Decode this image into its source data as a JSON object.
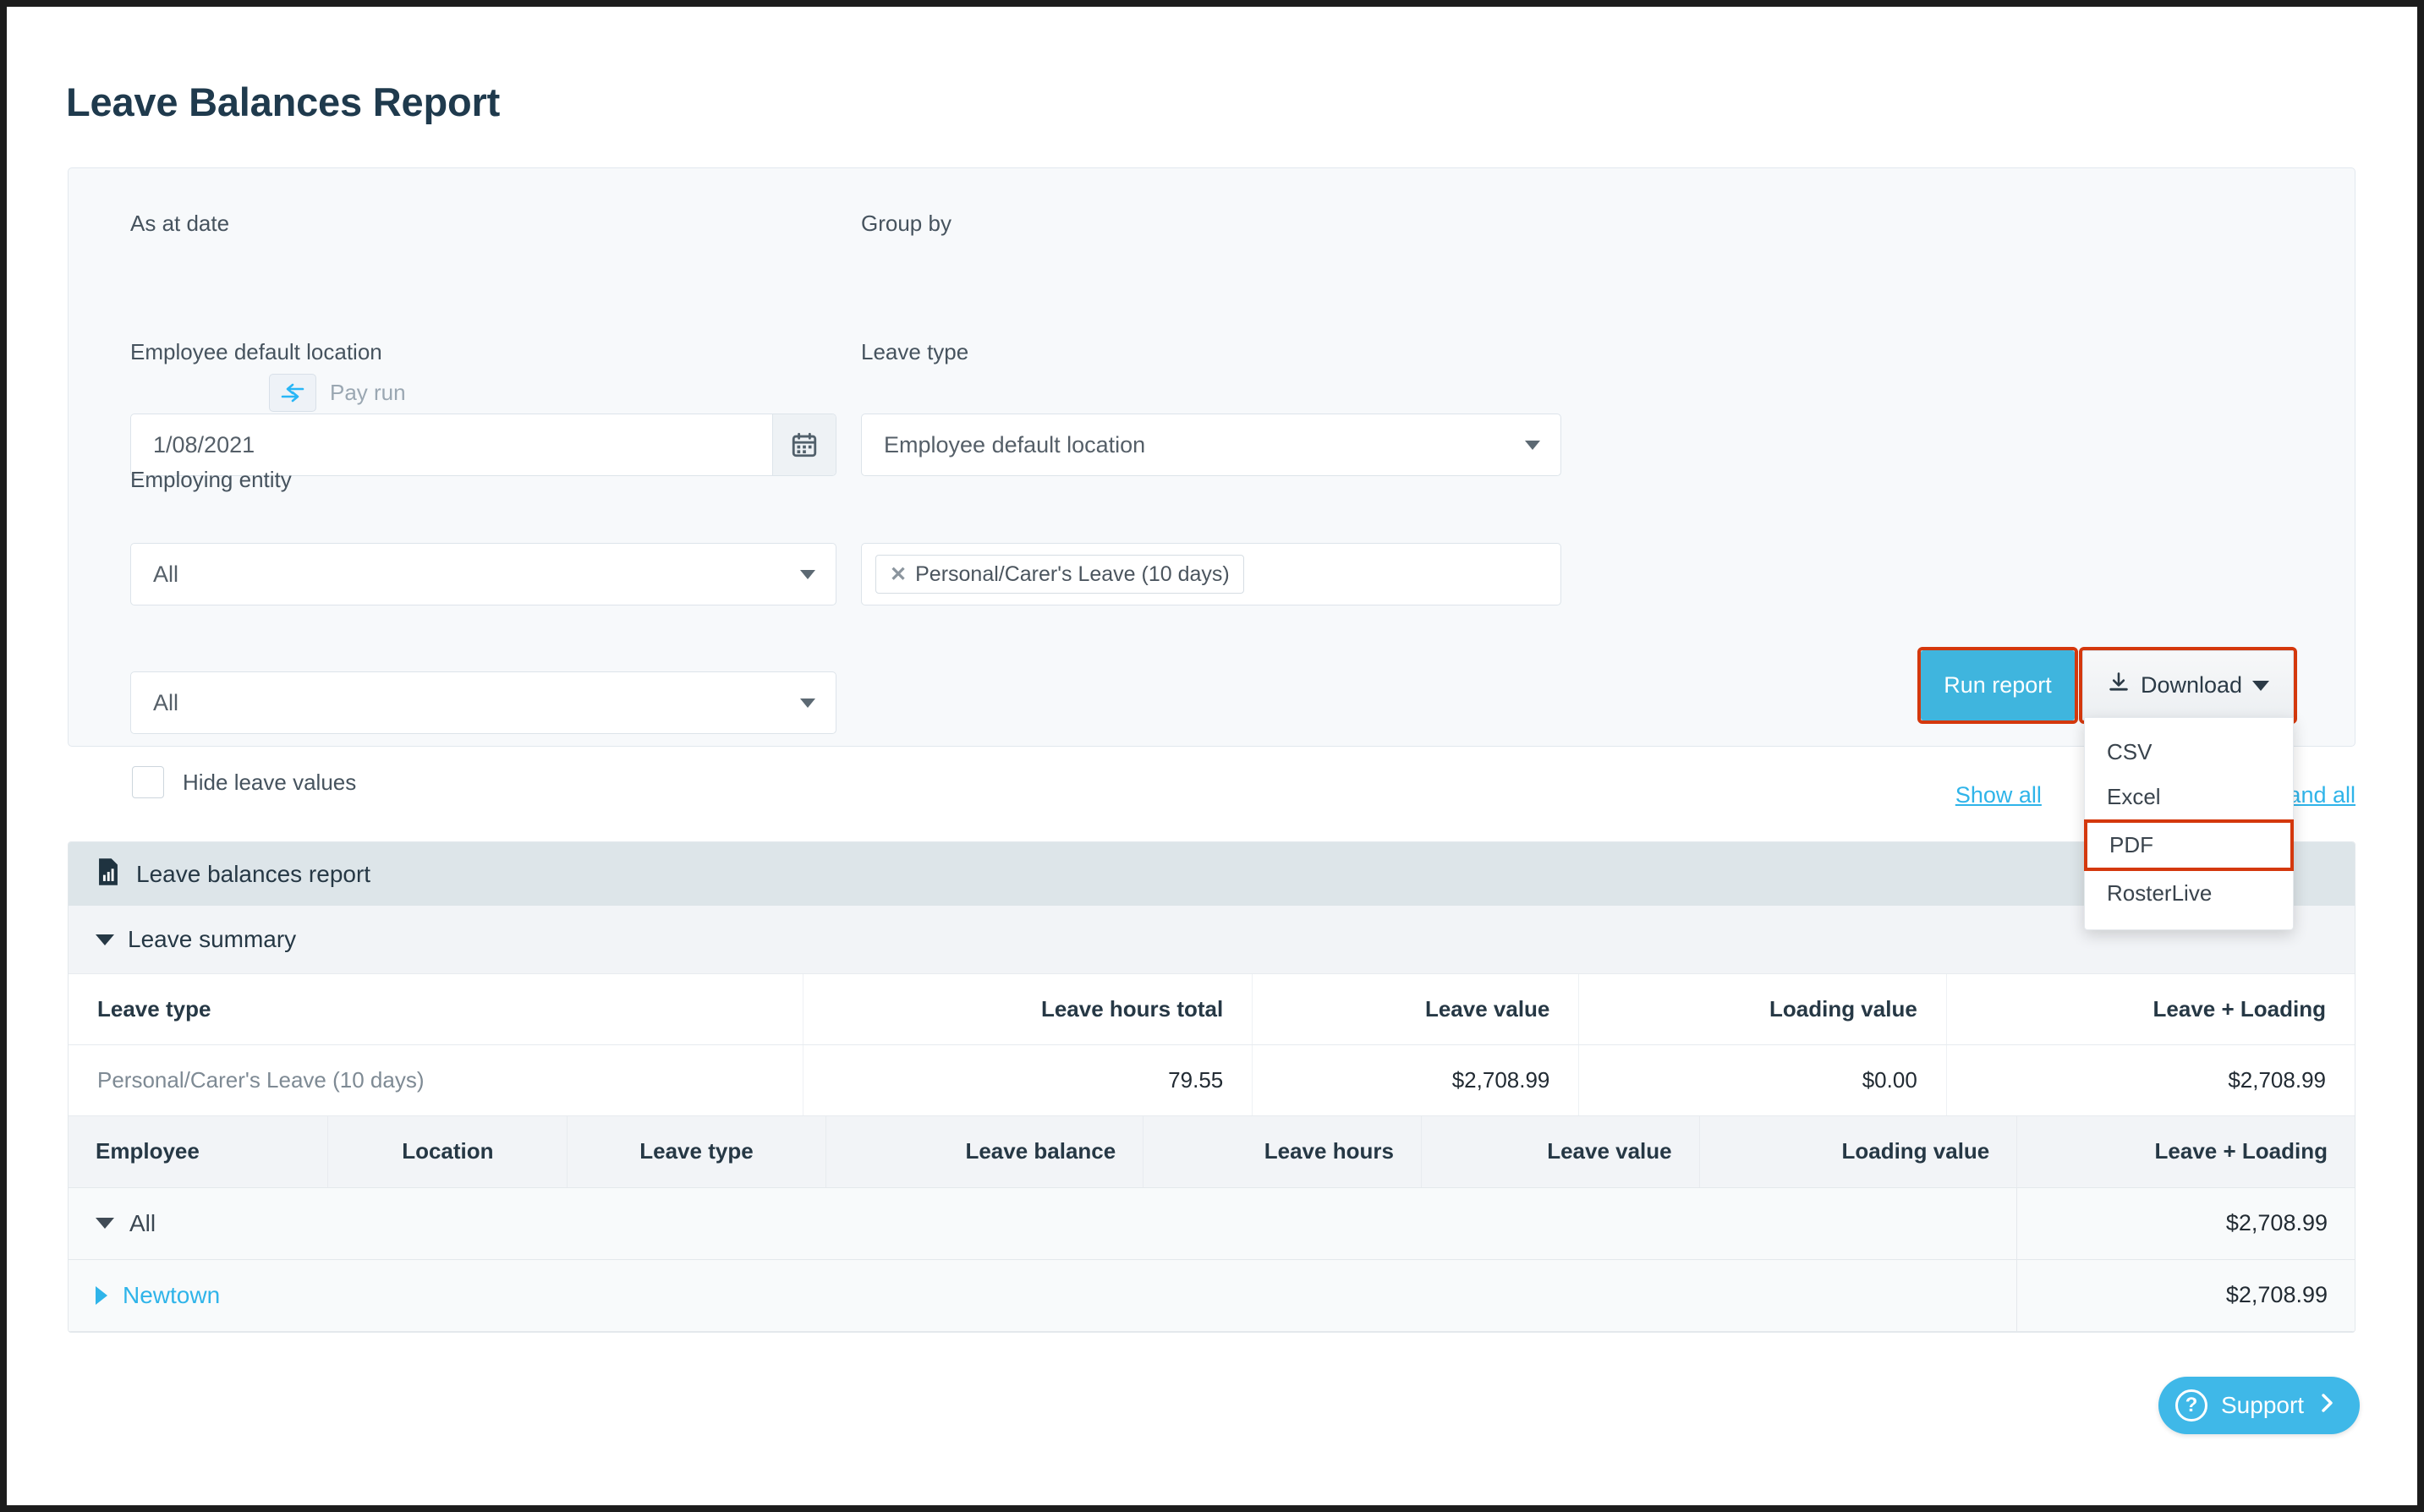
{
  "page": {
    "title": "Leave Balances Report"
  },
  "filters": {
    "as_at_date": {
      "label": "As at date",
      "value": "1/08/2021",
      "toggle_icon": "swap-arrows-icon",
      "pay_run_label": "Pay run",
      "calendar_icon": "calendar-icon"
    },
    "group_by": {
      "label": "Group by",
      "value": "Employee default location"
    },
    "employee_default_location": {
      "label": "Employee default location",
      "value": "All"
    },
    "leave_type": {
      "label": "Leave type",
      "chips": [
        "Personal/Carer's Leave (10 days)"
      ],
      "remove_icon": "close-x-icon"
    },
    "employing_entity": {
      "label": "Employing entity",
      "value": "All"
    },
    "hide_leave_values": {
      "label": "Hide leave values",
      "checked": false
    }
  },
  "actions": {
    "run_report": "Run report",
    "download": "Download",
    "download_icon": "download-icon",
    "download_menu": [
      "CSV",
      "Excel",
      "PDF",
      "RosterLive"
    ],
    "highlighted_menu_item": "PDF"
  },
  "links": {
    "show_all": "Show all",
    "expand_all": "Expand all"
  },
  "report": {
    "header_title": "Leave balances report",
    "header_icon": "report-document-icon",
    "summary_section_title": "Leave summary",
    "summary_table": {
      "columns": [
        "Leave type",
        "Leave hours total",
        "Leave value",
        "Loading value",
        "Leave + Loading"
      ],
      "rows": [
        [
          "Personal/Carer's Leave (10 days)",
          "79.55",
          "$2,708.99",
          "$0.00",
          "$2,708.99"
        ]
      ]
    },
    "detail_table": {
      "columns": [
        "Employee",
        "Location",
        "Leave type",
        "Leave balance",
        "Leave hours",
        "Leave value",
        "Loading value",
        "Leave + Loading"
      ],
      "group_rows": [
        {
          "label": "All",
          "expanded": true,
          "is_link": false,
          "total": "$2,708.99"
        },
        {
          "label": "Newtown",
          "expanded": false,
          "is_link": true,
          "total": "$2,708.99"
        }
      ]
    }
  },
  "support": {
    "label": "Support",
    "icon": "question-mark-icon",
    "chevron": "chevron-right-icon"
  },
  "colors": {
    "accent": "#3fb5de",
    "highlight": "#d4380d",
    "link": "#2fb4e9"
  }
}
